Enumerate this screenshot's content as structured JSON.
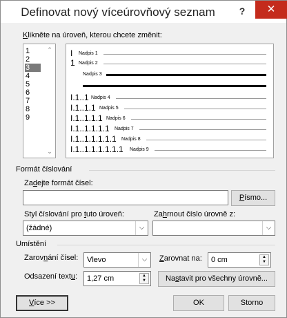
{
  "dialog": {
    "title": "Definovat nový víceúrovňový seznam",
    "help_label": "?",
    "close_label": "✕"
  },
  "levels": {
    "label_pre": "K",
    "label_post": "likněte na úroveň, kterou chcete změnit:",
    "items": [
      "1",
      "2",
      "3",
      "4",
      "5",
      "6",
      "7",
      "8",
      "9"
    ],
    "selected": "3"
  },
  "preview": {
    "rows": [
      {
        "num": "I",
        "text": "Nadpis 1"
      },
      {
        "num": "1",
        "text": "Nadpis 2"
      },
      {
        "num": "",
        "text": "Nadpis 3"
      },
      {
        "num": "",
        "text": ""
      },
      {
        "num": "I.1..1",
        "text": "Nadpis 4"
      },
      {
        "num": "I.1..1.1",
        "text": "Nadpis 5"
      },
      {
        "num": "I.1..1.1.1",
        "text": "Nadpis 6"
      },
      {
        "num": "I.1..1.1.1.1",
        "text": "Nadpis 7"
      },
      {
        "num": "I.1..1.1.1.1.1",
        "text": "Nadpis 8"
      },
      {
        "num": "I.1..1.1.1.1.1.1",
        "text": "Nadpis 9"
      }
    ]
  },
  "number_format": {
    "section_label": "Formát číslování",
    "format_label_pre": "Za",
    "format_label_u": "d",
    "format_label_post": "ejte formát čísel:",
    "format_value": "",
    "font_button_pre": "",
    "font_button_u": "P",
    "font_button_post": "ísmo...",
    "style_label_pre": "Styl číslování pro ",
    "style_label_u": "t",
    "style_label_post": "uto úroveň:",
    "style_value": "(žádné)",
    "include_label_pre": "Za",
    "include_label_u": "h",
    "include_label_post": "rnout číslo úrovně z:",
    "include_value": ""
  },
  "position": {
    "section_label": "Umístění",
    "align_label_pre": "Zarov",
    "align_label_u": "n",
    "align_label_post": "ání čísel:",
    "align_value": "Vlevo",
    "align_at_label_pre": "",
    "align_at_label_u": "Z",
    "align_at_label_post": "arovnat na:",
    "align_at_value": "0 cm",
    "indent_label_pre": "Odsazení text",
    "indent_label_u": "u",
    "indent_label_post": ":",
    "indent_value": "1,27 cm",
    "set_all_pre": "Na",
    "set_all_u": "s",
    "set_all_post": "tavit pro všechny úrovně..."
  },
  "footer": {
    "more_pre": "",
    "more_u": "V",
    "more_post": "íce >>",
    "ok_label": "OK",
    "cancel_label": "Storno"
  }
}
